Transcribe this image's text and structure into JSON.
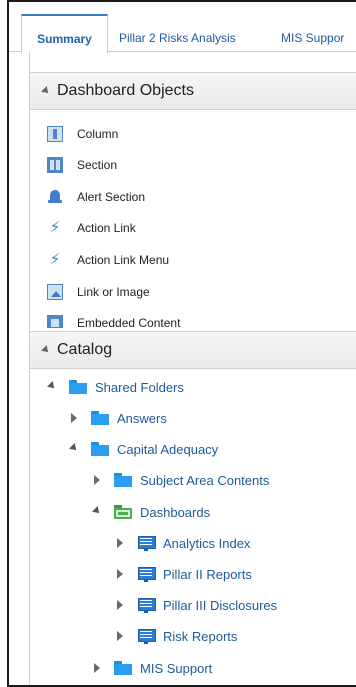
{
  "tabs": [
    {
      "label": "Summary",
      "active": true
    },
    {
      "label": "Pillar 2 Risks Analysis",
      "active": false
    },
    {
      "label": "MIS Suppor",
      "active": false
    }
  ],
  "dashboard_objects": {
    "title": "Dashboard Objects",
    "items": [
      {
        "label": "Column",
        "icon": "column-icon"
      },
      {
        "label": "Section",
        "icon": "section-icon"
      },
      {
        "label": "Alert Section",
        "icon": "alert-bell-icon"
      },
      {
        "label": "Action Link",
        "icon": "action-link-icon"
      },
      {
        "label": "Action Link Menu",
        "icon": "action-link-menu-icon"
      },
      {
        "label": "Link or Image",
        "icon": "link-image-icon"
      },
      {
        "label": "Embedded Content",
        "icon": "embedded-content-icon"
      }
    ]
  },
  "catalog": {
    "title": "Catalog",
    "tree": [
      {
        "label": "Shared Folders",
        "icon": "folder-icon",
        "expanded": true,
        "depth": 0
      },
      {
        "label": "Answers",
        "icon": "folder-icon",
        "expanded": false,
        "depth": 1
      },
      {
        "label": "Capital Adequacy",
        "icon": "folder-icon",
        "expanded": true,
        "depth": 1
      },
      {
        "label": "Subject Area Contents",
        "icon": "folder-icon",
        "expanded": false,
        "depth": 2
      },
      {
        "label": "Dashboards",
        "icon": "dashboard-folder-icon",
        "expanded": true,
        "depth": 2
      },
      {
        "label": "Analytics Index",
        "icon": "dashboard-icon",
        "expanded": false,
        "depth": 3
      },
      {
        "label": "Pillar II Reports",
        "icon": "dashboard-icon",
        "expanded": false,
        "depth": 3
      },
      {
        "label": "Pillar III Disclosures",
        "icon": "dashboard-icon",
        "expanded": false,
        "depth": 3
      },
      {
        "label": "Risk Reports",
        "icon": "dashboard-icon",
        "expanded": false,
        "depth": 3
      },
      {
        "label": "MIS Support",
        "icon": "folder-icon",
        "expanded": false,
        "depth": 1
      }
    ]
  },
  "colors": {
    "link": "#1f5a9c",
    "tab_active_border": "#3a7bc8",
    "folder": "#2a9df0",
    "dashboard_folder": "#4cae4c"
  }
}
